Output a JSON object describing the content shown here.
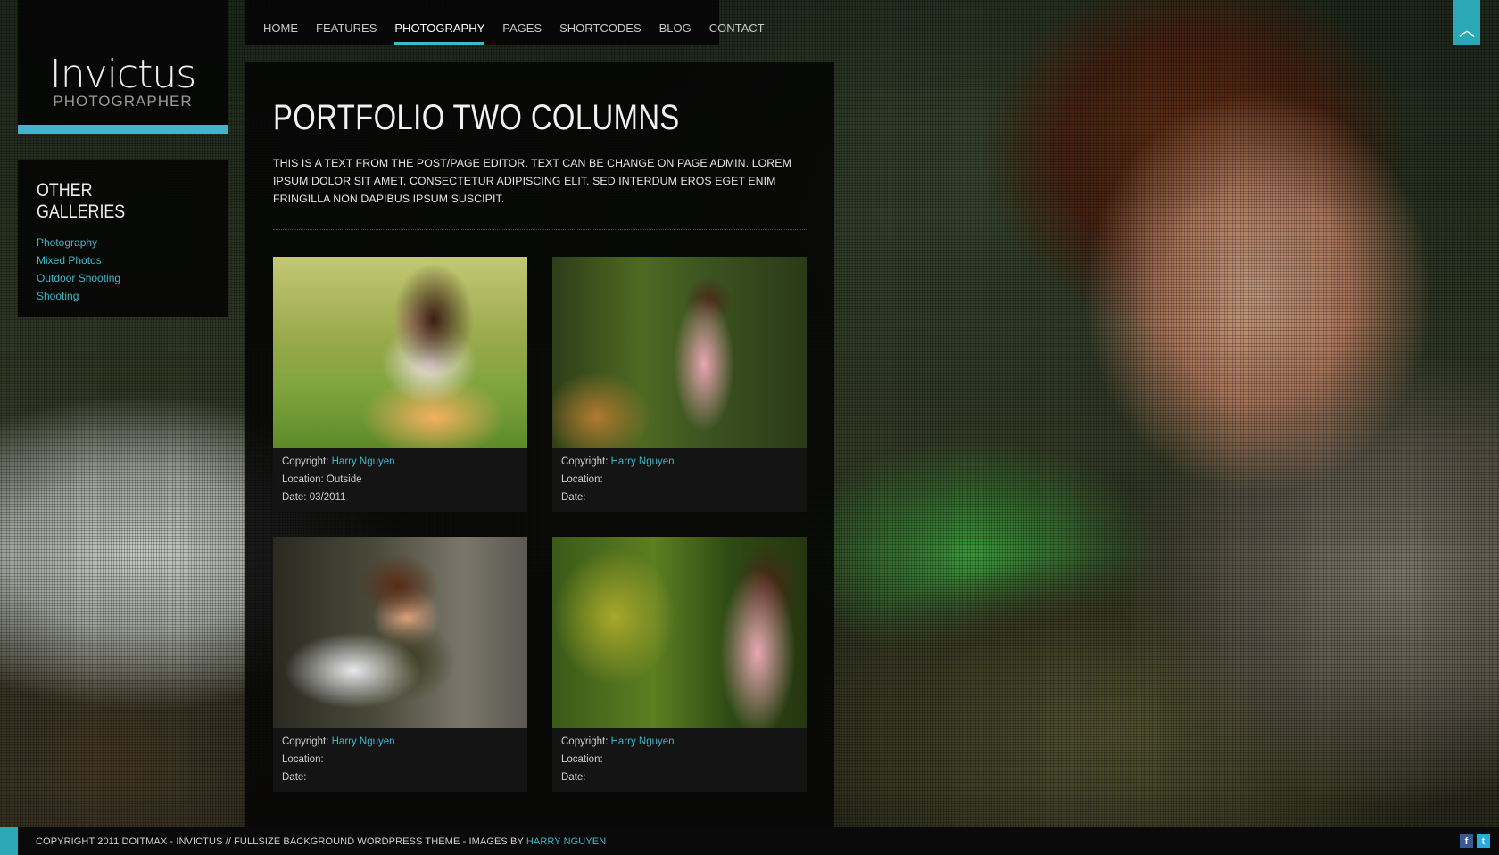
{
  "logo": {
    "title": "Invictus",
    "subtitle": "PHOTOGRAPHER"
  },
  "nav": {
    "items": [
      {
        "label": "HOME"
      },
      {
        "label": "FEATURES"
      },
      {
        "label": "PHOTOGRAPHY",
        "active": true
      },
      {
        "label": "PAGES"
      },
      {
        "label": "SHORTCODES"
      },
      {
        "label": "BLOG"
      },
      {
        "label": "CONTACT"
      }
    ]
  },
  "sidebar": {
    "heading": "OTHER GALLERIES",
    "links": [
      "Photography",
      "Mixed Photos",
      "Outdoor Shooting",
      "Shooting"
    ]
  },
  "main": {
    "title": "PORTFOLIO TWO COLUMNS",
    "intro": "THIS IS A TEXT FROM THE POST/PAGE EDITOR. TEXT CAN BE CHANGE ON PAGE ADMIN. LOREM IPSUM DOLOR SIT AMET, CONSECTETUR ADIPISCING ELIT. SED INTERDUM EROS EGET ENIM FRINGILLA NON DAPIBUS IPSUM SUSCIPIT.",
    "items": [
      {
        "copyright_label": "Copyright:",
        "copyright": "Harry Nguyen",
        "location_label": "Location:",
        "location": "Outside",
        "date_label": "Date:",
        "date": "03/2011"
      },
      {
        "copyright_label": "Copyright:",
        "copyright": "Harry Nguyen",
        "location_label": "Location:",
        "location": "",
        "date_label": "Date:",
        "date": ""
      },
      {
        "copyright_label": "Copyright:",
        "copyright": "Harry Nguyen",
        "location_label": "Location:",
        "location": "",
        "date_label": "Date:",
        "date": ""
      },
      {
        "copyright_label": "Copyright:",
        "copyright": "Harry Nguyen",
        "location_label": "Location:",
        "location": "",
        "date_label": "Date:",
        "date": ""
      }
    ]
  },
  "footer": {
    "text": "COPYRIGHT 2011 DOITMAX - INVICTUS // FULLSIZE BACKGROUND WORDPRESS THEME - IMAGES BY ",
    "link": "HARRY NGUYEN",
    "social": [
      "facebook-icon",
      "twitter-icon"
    ]
  },
  "colors": {
    "accent": "#3fb7c8",
    "panel": "#050505"
  },
  "icons": {
    "totop": "chevron-up-icon"
  }
}
